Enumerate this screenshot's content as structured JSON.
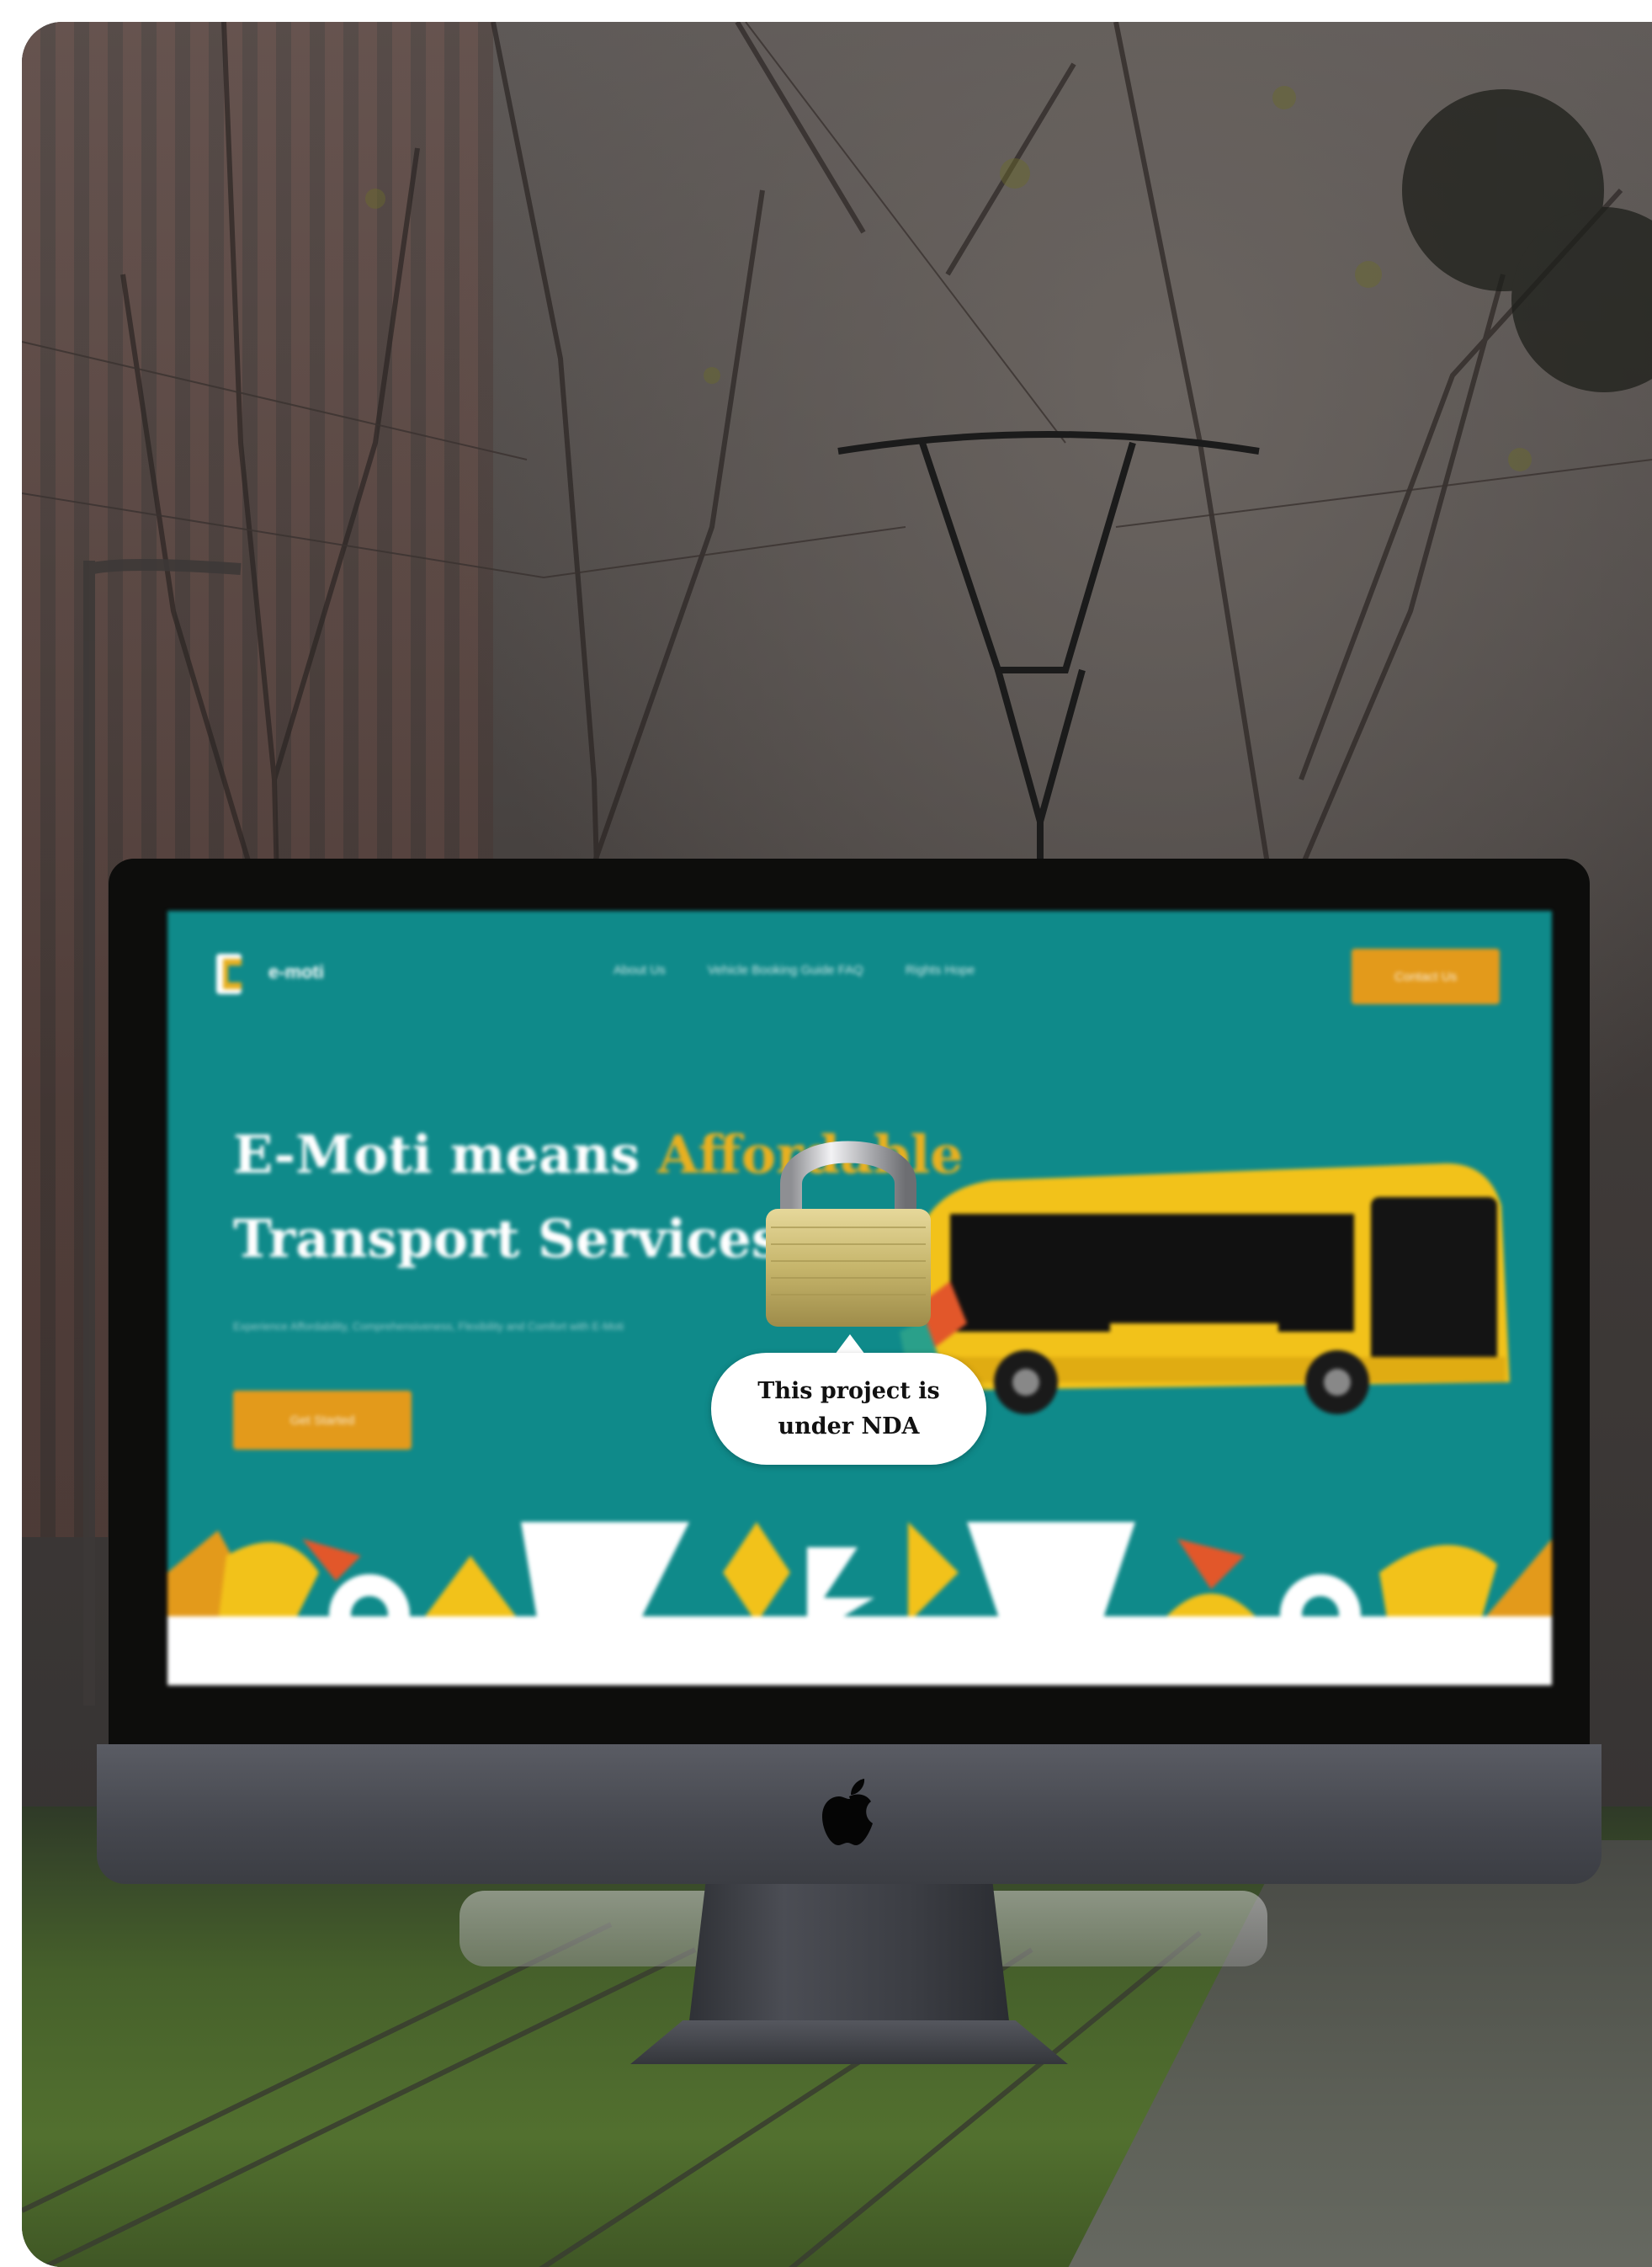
{
  "nda_notice": {
    "text": "This project is under NDA",
    "icon": "lock-icon"
  },
  "website_preview": {
    "brand": "e-moti",
    "nav_items": [
      "About Us",
      "Vehicle Booking Guide FAQ",
      "Rights Hope"
    ],
    "cta_label": "Contact Us",
    "hero_title_prefix": "E-Moti means ",
    "hero_title_highlight": "Affordable",
    "hero_title_suffix": "Transport Services",
    "hero_subtitle": "Experience Affordability, Comprehensiveness, Flexibility and Comfort with E-Moti",
    "hero_button_label": "Get Started"
  },
  "colors": {
    "site_teal": "#0f8a8a",
    "site_accent": "#e39a1b",
    "highlight_yellow": "#e8b020",
    "bezel": "#0d0d0c",
    "chin": "#4a4c53"
  }
}
